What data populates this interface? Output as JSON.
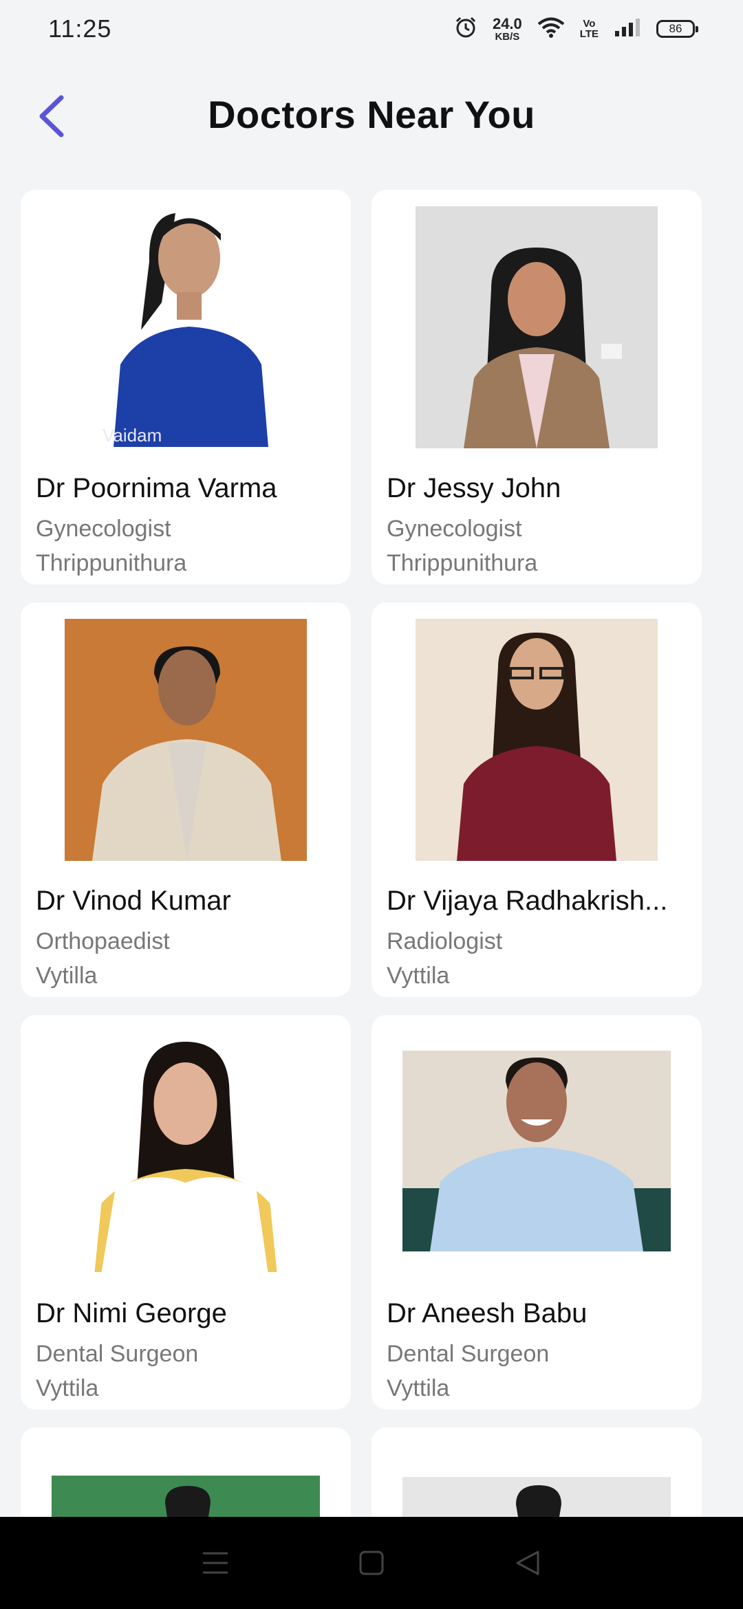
{
  "status_bar": {
    "time": "11:25",
    "net_speed_value": "24.0",
    "net_speed_unit": "KB/S",
    "volte_top": "Vo",
    "volte_bottom": "LTE",
    "battery": "86"
  },
  "header": {
    "title": "Doctors Near You",
    "back_icon": "chevron-left-icon"
  },
  "doctors": [
    {
      "name": "Dr Poornima Varma",
      "specialty": "Gynecologist",
      "location": "Thrippunithura",
      "watermark": "Vaidam"
    },
    {
      "name": "Dr Jessy John",
      "specialty": "Gynecologist",
      "location": "Thrippunithura"
    },
    {
      "name": "Dr Vinod Kumar",
      "specialty": "Orthopaedist",
      "location": "Vytilla"
    },
    {
      "name": "Dr Vijaya Radhakrish...",
      "specialty": "Radiologist",
      "location": "Vyttila"
    },
    {
      "name": "Dr Nimi George",
      "specialty": "Dental Surgeon",
      "location": "Vyttila"
    },
    {
      "name": "Dr Aneesh Babu",
      "specialty": "Dental Surgeon",
      "location": "Vyttila"
    }
  ],
  "nav": {
    "menu_icon": "menu-icon",
    "home_icon": "home-square-icon",
    "back_icon": "back-triangle-icon"
  },
  "colors": {
    "accent": "#5a55d6",
    "background": "#f2f4f6",
    "card": "#ffffff"
  }
}
